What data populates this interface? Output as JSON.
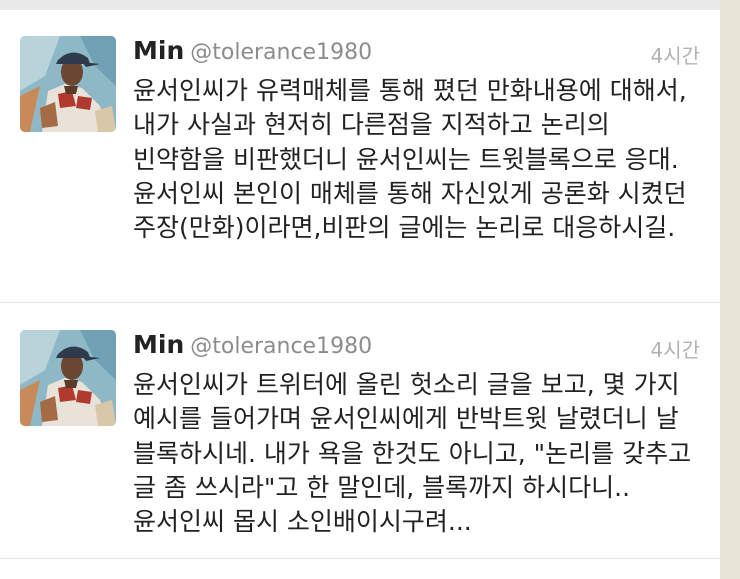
{
  "tweets": [
    {
      "name": "Min",
      "handle": "@tolerance1980",
      "time": "4시간",
      "text": "윤서인씨가 유력매체를 통해 폈던 만화내용에 대해서, 내가 사실과 현저히 다른점을 지적하고 논리의 빈약함을 비판했더니 윤서인씨는 트윗블록으로 응대. 윤서인씨 본인이 매체를 통해 자신있게 공론화 시켰던 주장(만화)이라면,비판의 글에는 논리로 대응하시길."
    },
    {
      "name": "Min",
      "handle": "@tolerance1980",
      "time": "4시간",
      "text": "윤서인씨가 트위터에 올린 헛소리 글을 보고, 몇 가지 예시를 들어가며 윤서인씨에게 반박트윗 날렸더니 날 블록하시네. 내가 욕을 한것도 아니고, \"논리를 갖추고 글 좀 쓰시라\"고 한 말인데, 블록까지 하시다니.. 윤서인씨 몹시 소인배이시구려..."
    }
  ],
  "avatar_icon": "baseball-player-painting-icon"
}
